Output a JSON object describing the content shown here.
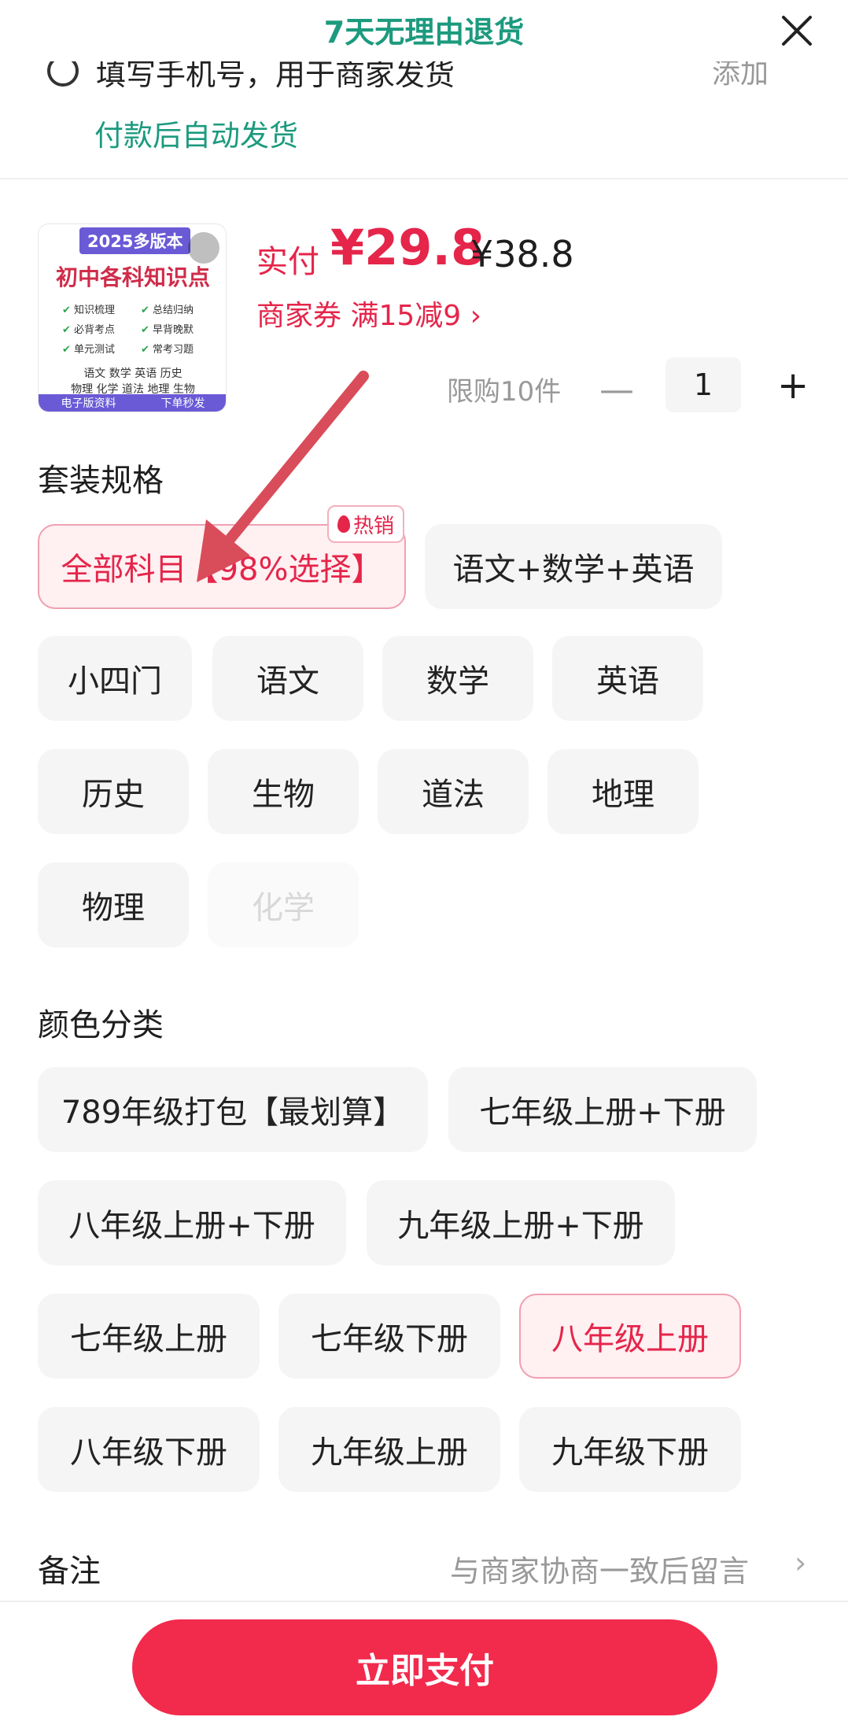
{
  "header": {
    "title": "7天无理由退货"
  },
  "contact": {
    "text": "填写手机号，用于商家发货",
    "add_label": "添加",
    "auto_ship": "付款后自动发货"
  },
  "product": {
    "thumb": {
      "badge": "2025多版本",
      "title": "初中各科知识点",
      "features": [
        "知识梳理",
        "总结归纳",
        "必背考点",
        "早背晚默",
        "单元测试",
        "常考习题"
      ],
      "subjects_line1": "语文  数学  英语  历史",
      "subjects_line2": "物理  化学  道法  地理  生物",
      "footer_left": "电子版资料",
      "footer_right": "下单秒发"
    },
    "pay_label": "实付",
    "price": "¥29.8",
    "original_price": "¥38.8",
    "coupon": "商家券 满15减9 ›",
    "limit": "限购10件",
    "quantity": "1"
  },
  "bundle": {
    "title": "套装规格",
    "hot_tag": "热销",
    "options": [
      "全部科目【98%选择】",
      "语文+数学+英语",
      "小四门",
      "语文",
      "数学",
      "英语",
      "历史",
      "生物",
      "道法",
      "地理",
      "物理",
      "化学"
    ],
    "selected": "全部科目【98%选择】",
    "disabled": "化学"
  },
  "color": {
    "title": "颜色分类",
    "options": [
      "789年级打包【最划算】",
      "七年级上册+下册",
      "八年级上册+下册",
      "九年级上册+下册",
      "七年级上册",
      "七年级下册",
      "八年级上册",
      "八年级下册",
      "九年级上册",
      "九年级下册"
    ],
    "selected": "八年级上册"
  },
  "remark": {
    "label": "备注",
    "hint": "与商家协商一致后留言"
  },
  "footer": {
    "pay_button": "立即支付"
  },
  "colors": {
    "accent_red": "#e5254a",
    "accent_green": "#1c9a7e",
    "annotation_arrow": "#d94c5a"
  }
}
